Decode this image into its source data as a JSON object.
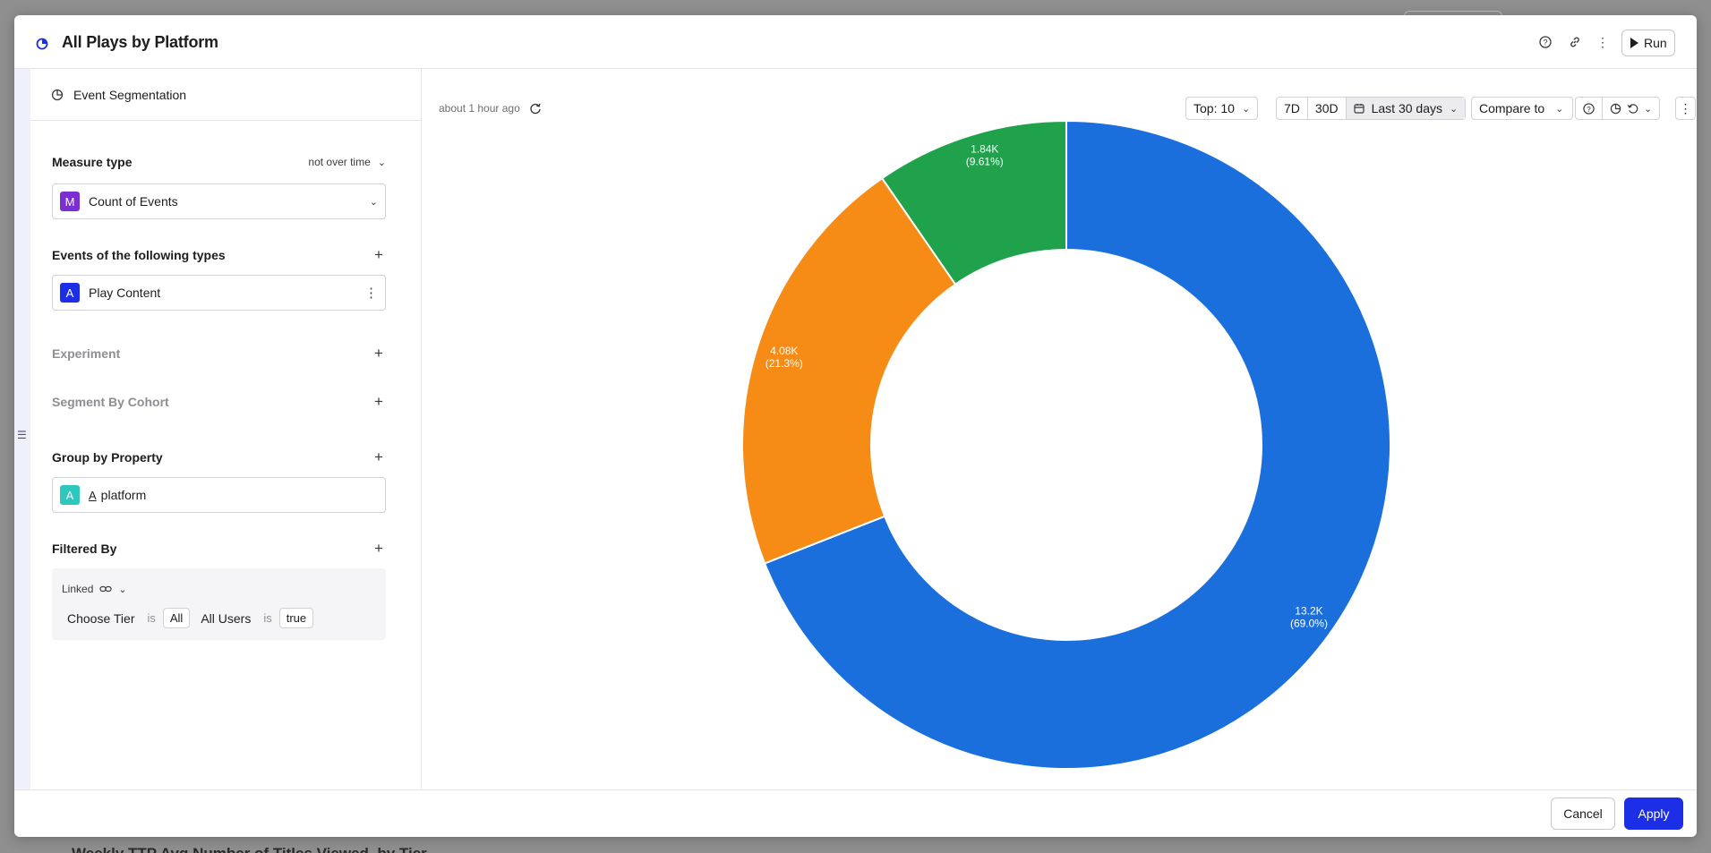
{
  "backdrop": {
    "bottom_text": "Weekly TTP Avg Number of Titles Viewed, by Tier"
  },
  "header": {
    "title": "All Plays by Platform",
    "run_label": "Run",
    "icons": [
      "help-circle-icon",
      "link-icon",
      "more-vertical-icon",
      "play-icon"
    ]
  },
  "left_panel": {
    "mode_label": "Event Segmentation",
    "measure_type": {
      "label": "Measure type",
      "dropdown": "not over time",
      "badge": "M",
      "value": "Count of Events"
    },
    "events": {
      "label": "Events of the following types",
      "badge": "A",
      "value": "Play Content"
    },
    "experiment_label": "Experiment",
    "cohort_label": "Segment By Cohort",
    "group_by": {
      "label": "Group by Property",
      "badge": "A",
      "type_glyph": "A",
      "value": "platform"
    },
    "filtered_by": {
      "label": "Filtered By",
      "linked_label": "Linked",
      "conditions": [
        {
          "property": "Choose Tier",
          "operator": "is",
          "value": "All"
        },
        {
          "property": "All Users",
          "operator": "is",
          "value": "true"
        }
      ]
    }
  },
  "chart_panel": {
    "updated": "about 1 hour ago",
    "top_n": "Top: 10",
    "range_7d": "7D",
    "range_30d": "30D",
    "date_range": "Last 30 days",
    "compare": "Compare to"
  },
  "chart_data": {
    "type": "pie",
    "series": [
      {
        "value": 13200,
        "label": "13.2K",
        "percent": "(69.0%)",
        "color": "#1a6fdd"
      },
      {
        "value": 4080,
        "label": "4.08K",
        "percent": "(21.3%)",
        "color": "#f68b16"
      },
      {
        "value": 1840,
        "label": "1.84K",
        "percent": "(9.61%)",
        "color": "#1fa24b"
      }
    ],
    "donut": true
  },
  "footer": {
    "cancel_label": "Cancel",
    "apply_label": "Apply"
  },
  "colors": {
    "accent": "#1c2ee6",
    "badge_measure": "#7b2fd1",
    "badge_event": "#1c2ee6",
    "badge_property": "#2ec7bd"
  }
}
